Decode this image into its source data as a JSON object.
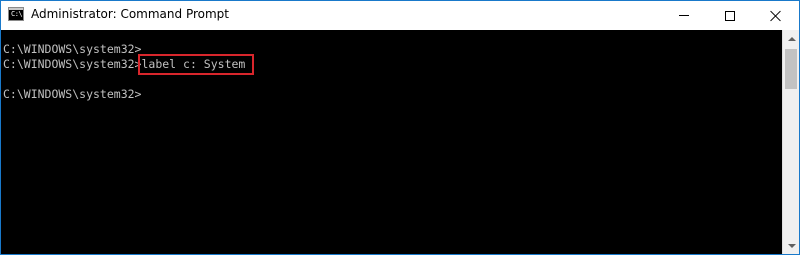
{
  "window": {
    "title": "Administrator: Command Prompt",
    "icon": "cmd-icon",
    "icon_glyph": "C:\\"
  },
  "controls": {
    "minimize_icon": "minimize-icon",
    "maximize_icon": "maximize-icon",
    "close_icon": "close-icon"
  },
  "console": {
    "lines": [
      {
        "prompt": "C:\\WINDOWS\\system32>",
        "command": ""
      },
      {
        "prompt": "C:\\WINDOWS\\system32>",
        "command": "label c: System"
      },
      {
        "prompt": "",
        "command": ""
      },
      {
        "prompt": "C:\\WINDOWS\\system32>",
        "command": ""
      }
    ],
    "text_color": "#c0c0c0",
    "background": "#000000",
    "highlight_color": "#d9262c"
  }
}
